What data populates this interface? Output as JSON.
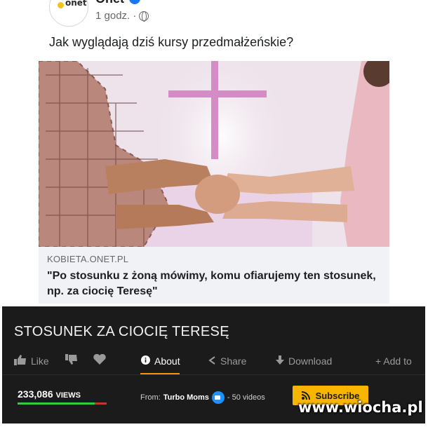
{
  "post": {
    "page_name": "Onet",
    "avatar_logo": "onet",
    "time": "1 godz. ·",
    "text": "Jak wyglądają dziś kursy przedmałżeńskie?",
    "link": {
      "domain": "KOBIETA.ONET.PL",
      "headline": "\"Po stosunku z żoną mówimy, komu ofiarujemy ten stosunek, np. za ciocię Teresę\""
    }
  },
  "video": {
    "title": "STOSUNEK ZA CIOCIĘ TERESĘ",
    "actions": {
      "like": "Like",
      "about": "About",
      "share": "Share",
      "download": "Download",
      "add_to": "+ Add to"
    },
    "views_number": "233,086",
    "views_label": "VIEWS",
    "rating_fraction": 0.87,
    "from_label": "From:",
    "channel": "Turbo Moms",
    "videos_count": "- 50 videos",
    "subscribe": "Subscribe"
  },
  "watermark": "www.wiocha.pl",
  "colors": {
    "accent": "#ff9000",
    "subscribe_bg": "#f7b500",
    "facebook_blue": "#1877f2",
    "video_bg": "#1b1b1b"
  },
  "icons": [
    "globe-icon",
    "verified-icon",
    "thumbs-up-icon",
    "thumbs-down-icon",
    "heart-icon",
    "info-icon",
    "share-icon",
    "download-icon",
    "channel-camera-icon",
    "rss-icon"
  ]
}
